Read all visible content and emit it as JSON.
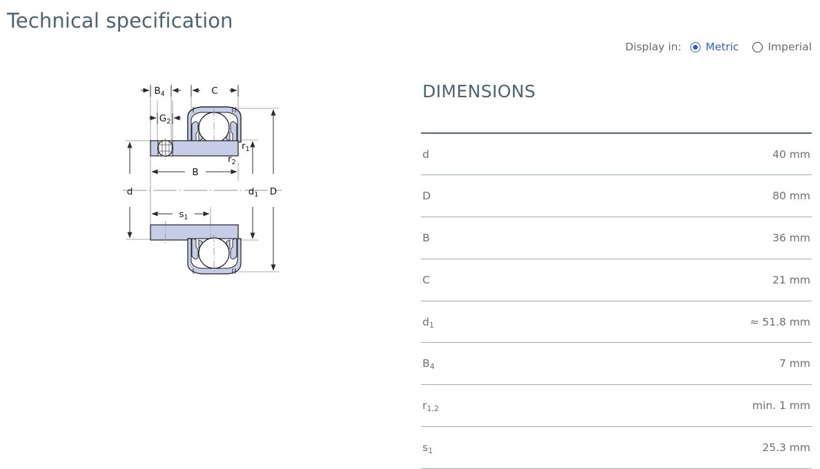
{
  "page": {
    "title": "Technical specification",
    "title_color": "#4a6375"
  },
  "display_toggle": {
    "label": "Display in:",
    "selected": "Metric",
    "accent_color": "#2b5fd9",
    "options": [
      {
        "label": "Metric",
        "selected": true
      },
      {
        "label": "Imperial",
        "selected": false
      }
    ]
  },
  "dimensions": {
    "heading": "DIMENSIONS",
    "rows": [
      {
        "symbol": "d",
        "sub": "",
        "value": "40 mm"
      },
      {
        "symbol": "D",
        "sub": "",
        "value": "80 mm"
      },
      {
        "symbol": "B",
        "sub": "",
        "value": "36 mm"
      },
      {
        "symbol": "C",
        "sub": "",
        "value": "21 mm"
      },
      {
        "symbol": "d",
        "sub": "1",
        "value": "≈ 51.8 mm"
      },
      {
        "symbol": "B",
        "sub": "4",
        "value": "7 mm"
      },
      {
        "symbol": "r",
        "sub": "1,2",
        "value": "min. 1 mm"
      },
      {
        "symbol": "s",
        "sub": "1",
        "value": "25.3 mm"
      }
    ]
  },
  "drawing": {
    "title": "bearing-cross-section",
    "fill_color": "#c6cee7",
    "line_color": "#1a1a1a",
    "dim_line_color": "#3a3a3a",
    "center_line_color": "#8d8d8d",
    "labels": [
      {
        "name": "B4",
        "symbol": "B",
        "sub": "4"
      },
      {
        "name": "C",
        "symbol": "C",
        "sub": ""
      },
      {
        "name": "G2",
        "symbol": "G",
        "sub": "2"
      },
      {
        "name": "B",
        "symbol": "B",
        "sub": ""
      },
      {
        "name": "d",
        "symbol": "d",
        "sub": ""
      },
      {
        "name": "D",
        "symbol": "D",
        "sub": ""
      },
      {
        "name": "d1",
        "symbol": "d",
        "sub": "1"
      },
      {
        "name": "r1",
        "symbol": "r",
        "sub": "1"
      },
      {
        "name": "r2",
        "symbol": "r",
        "sub": "2"
      },
      {
        "name": "s1",
        "symbol": "s",
        "sub": "1"
      }
    ]
  }
}
